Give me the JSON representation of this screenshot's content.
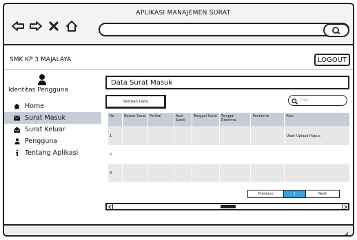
{
  "app": {
    "title": "APLIKASI MANAJEMEN SURAT"
  },
  "browser": {
    "nav_icons": [
      "back-arrow-icon",
      "forward-arrow-icon",
      "close-icon",
      "home-icon"
    ],
    "search_icon": "search-icon"
  },
  "header": {
    "school": "SMK KP 3 MAJALAYA",
    "logout_label": "LOGOUT"
  },
  "sidebar": {
    "user_label": "Identitas Pengguna",
    "items": [
      {
        "label": "Home",
        "icon": "home-icon",
        "active": false
      },
      {
        "label": "Surat Masuk",
        "icon": "envelope-icon",
        "active": true
      },
      {
        "label": "Surat Keluar",
        "icon": "outbox-icon",
        "active": false
      },
      {
        "label": "Pengguna",
        "icon": "user-icon",
        "active": false
      },
      {
        "label": "Tentang Aplikasi",
        "icon": "info-icon",
        "active": false
      }
    ]
  },
  "main": {
    "title": "Data Surat Masuk",
    "add_button": "Tambah Data",
    "search_placeholder": "Cari",
    "table": {
      "columns": [
        "No",
        "Nomor Surat",
        "Perihal",
        "Asal Surat",
        "Tanggal Surat",
        "Tanggal Diterima",
        "Penerima",
        "Aksi"
      ],
      "rows": [
        [
          "1",
          "",
          "",
          "",
          "",
          "",
          "",
          "Ubah Upload Hapus"
        ],
        [
          "2",
          "",
          "",
          "",
          "",
          "",
          "",
          ""
        ],
        [
          "3",
          "",
          "",
          "",
          "",
          "",
          "",
          ""
        ]
      ]
    },
    "pagination": {
      "previous": "Previous",
      "page": "1",
      "next": "Next"
    }
  },
  "colors": {
    "accent": "#3aa0e6",
    "header_fill": "#c7cdd8",
    "row_stripe": "#e7e7e7"
  }
}
